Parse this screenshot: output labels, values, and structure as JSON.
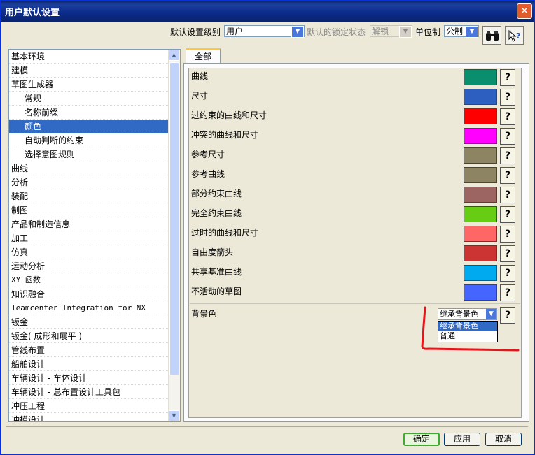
{
  "window": {
    "title": "用户默认设置",
    "close_glyph": "✕"
  },
  "toolbar": {
    "level_label": "默认设置级别",
    "level_value": "用户",
    "lock_label": "默认的锁定状态",
    "lock_value": "解锁",
    "unit_label": "单位制",
    "unit_value": "公制"
  },
  "icons": {
    "find": "binoculars-icon",
    "help_pointer": "arrow-help-icon",
    "help": "?"
  },
  "tree": [
    {
      "label": "基本环境",
      "level": 0
    },
    {
      "label": "建模",
      "level": 0
    },
    {
      "label": "草图生成器",
      "level": 0
    },
    {
      "label": "常规",
      "level": 1
    },
    {
      "label": "名称前缀",
      "level": 1
    },
    {
      "label": "颜色",
      "level": 1,
      "selected": true
    },
    {
      "label": "自动判断的约束",
      "level": 1
    },
    {
      "label": "选择意图规则",
      "level": 1
    },
    {
      "label": "曲线",
      "level": 0
    },
    {
      "label": "分析",
      "level": 0
    },
    {
      "label": "装配",
      "level": 0
    },
    {
      "label": "制图",
      "level": 0
    },
    {
      "label": "产品和制造信息",
      "level": 0
    },
    {
      "label": "加工",
      "level": 0
    },
    {
      "label": "仿真",
      "level": 0
    },
    {
      "label": "运动分析",
      "level": 0
    },
    {
      "label": "XY 函数",
      "level": 0
    },
    {
      "label": "知识融合",
      "level": 0
    },
    {
      "label": "Teamcenter Integration for NX",
      "level": 0
    },
    {
      "label": "钣金",
      "level": 0
    },
    {
      "label": "钣金( 成形和展平 )",
      "level": 0
    },
    {
      "label": "管线布置",
      "level": 0
    },
    {
      "label": "船舶设计",
      "level": 0
    },
    {
      "label": "车辆设计 - 车体设计",
      "level": 0
    },
    {
      "label": "车辆设计 - 总布置设计工具包",
      "level": 0
    },
    {
      "label": "冲压工程",
      "level": 0
    },
    {
      "label": "冲模设计",
      "level": 0
    }
  ],
  "tab": {
    "label": "全部"
  },
  "color_rows": [
    {
      "label": "曲线",
      "color": "#0a8f6e"
    },
    {
      "label": "尺寸",
      "color": "#2d5fc0"
    },
    {
      "label": "过约束的曲线和尺寸",
      "color": "#ff0000"
    },
    {
      "label": "冲突的曲线和尺寸",
      "color": "#ff00ff"
    },
    {
      "label": "参考尺寸",
      "color": "#8c8462"
    },
    {
      "label": "参考曲线",
      "color": "#8c8462"
    },
    {
      "label": "部分约束曲线",
      "color": "#9c6561"
    },
    {
      "label": "完全约束曲线",
      "color": "#66cc14"
    },
    {
      "label": "过时的曲线和尺寸",
      "color": "#ff6666"
    },
    {
      "label": "自由度箭头",
      "color": "#cc3333"
    },
    {
      "label": "共享基准曲线",
      "color": "#00aaee"
    },
    {
      "label": "不活动的草图",
      "color": "#4466ff"
    }
  ],
  "background": {
    "label": "背景色",
    "value": "继承背景色",
    "options": [
      "继承背景色",
      "普通"
    ]
  },
  "buttons": {
    "ok": "确定",
    "apply": "应用",
    "cancel": "取消"
  }
}
